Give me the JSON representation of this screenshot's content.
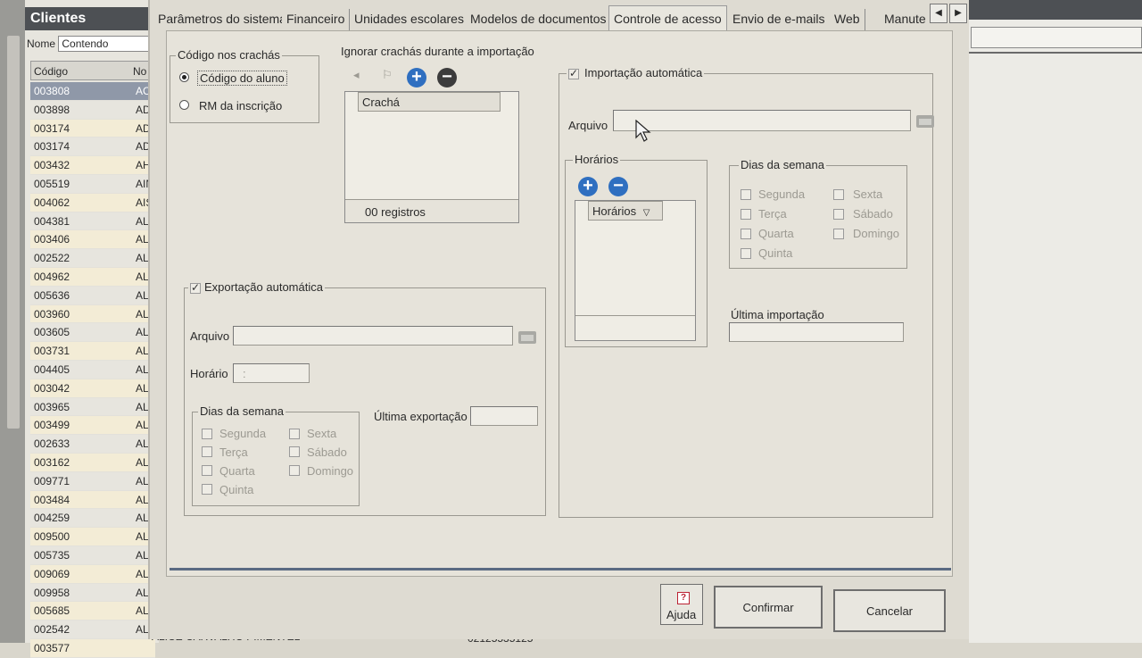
{
  "client_window": {
    "title": "Clientes",
    "filter_label": "Nome",
    "filter_value": "Contendo",
    "columns": [
      "Código",
      "No"
    ],
    "rows": [
      {
        "code": "003808",
        "name": "AC"
      },
      {
        "code": "003898",
        "name": "AD"
      },
      {
        "code": "003174",
        "name": "AD"
      },
      {
        "code": "003174",
        "name": "AD"
      },
      {
        "code": "003432",
        "name": "AH"
      },
      {
        "code": "005519",
        "name": "AIN"
      },
      {
        "code": "004062",
        "name": "AIS"
      },
      {
        "code": "004381",
        "name": "ALE"
      },
      {
        "code": "003406",
        "name": "ALE"
      },
      {
        "code": "002522",
        "name": "ALE"
      },
      {
        "code": "004962",
        "name": "ALE"
      },
      {
        "code": "005636",
        "name": "ALE"
      },
      {
        "code": "003960",
        "name": "ALE"
      },
      {
        "code": "003605",
        "name": "ALE"
      },
      {
        "code": "003731",
        "name": "ALE"
      },
      {
        "code": "004405",
        "name": "ALE"
      },
      {
        "code": "003042",
        "name": "ALE"
      },
      {
        "code": "003965",
        "name": "ALE"
      },
      {
        "code": "003499",
        "name": "ALE"
      },
      {
        "code": "002633",
        "name": "ALE"
      },
      {
        "code": "003162",
        "name": "ALF"
      },
      {
        "code": "009771",
        "name": "ALI"
      },
      {
        "code": "003484",
        "name": "ALI"
      },
      {
        "code": "004259",
        "name": "ALI"
      },
      {
        "code": "009500",
        "name": "ALI"
      },
      {
        "code": "005735",
        "name": "ALI"
      },
      {
        "code": "009069",
        "name": "ALI"
      },
      {
        "code": "009958",
        "name": "ALI"
      },
      {
        "code": "005685",
        "name": "ALI"
      },
      {
        "code": "002542",
        "name": "ALI"
      },
      {
        "code": "003577",
        "name": ""
      }
    ],
    "bottom_name": "ALICE CARVALHO PIMENTEL",
    "bottom_phone": "02125535125"
  },
  "tabs": [
    "Parâmetros do sistema",
    "Financeiro",
    "Unidades escolares",
    "Modelos de documentos",
    "Controle de acesso",
    "Envio de e-mails",
    "Web",
    "Manute"
  ],
  "tab_arrows": [
    "◀",
    "▶"
  ],
  "badge_code": {
    "legend": "Código nos crachás",
    "options": [
      "Código do aluno",
      "RM da inscrição"
    ],
    "selected": "Código do aluno"
  },
  "ignore_badges": {
    "title": "Ignorar crachás durante a importação",
    "column": "Crachá",
    "footer": "00 registros"
  },
  "auto_export": {
    "legend": "Exportação automática",
    "checked": true,
    "file_label": "Arquivo",
    "time_label": "Horário",
    "time_value": ":",
    "weekdays_legend": "Dias da semana",
    "weekdays": [
      "Segunda",
      "Terça",
      "Quarta",
      "Quinta",
      "Sexta",
      "Sábado",
      "Domingo"
    ],
    "last_label": "Última exportação"
  },
  "auto_import": {
    "legend": "Importação automática",
    "checked": true,
    "file_label": "Arquivo",
    "schedules_legend": "Horários",
    "schedules_column": "Horários",
    "weekdays_legend": "Dias da semana",
    "weekdays": [
      "Segunda",
      "Terça",
      "Quarta",
      "Quinta",
      "Sexta",
      "Sábado",
      "Domingo"
    ],
    "last_label": "Última importação"
  },
  "buttons": {
    "help": "Ajuda",
    "confirm": "Confirmar",
    "cancel": "Cancelar"
  }
}
